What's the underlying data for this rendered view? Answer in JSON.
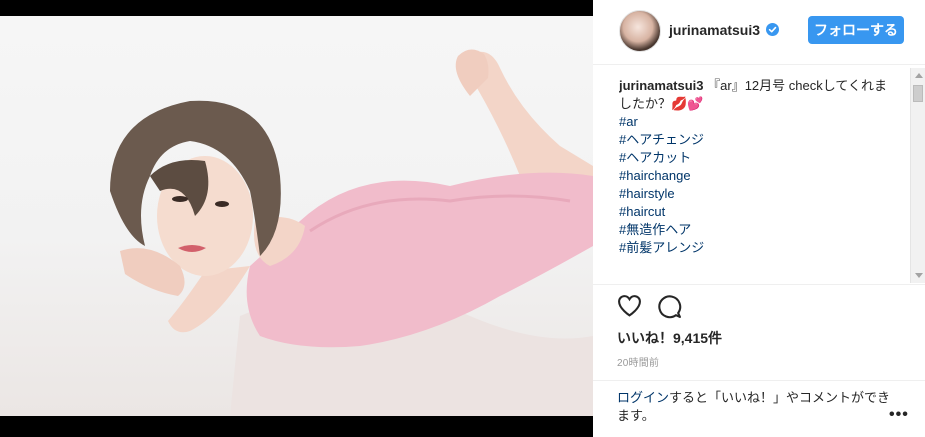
{
  "post": {
    "username": "jurinamatsui3",
    "follow_label": "フォローする",
    "caption_user": "jurinamatsui3",
    "caption_text": " 『ar』12月号 checkしてくれましたか？💋💕",
    "hashtags": [
      "#ar",
      "#ヘアチェンジ",
      "#ヘアカット",
      "#hairchange",
      "#hairstyle",
      "#haircut",
      "#無造作ヘア",
      "#前髪アレンジ"
    ],
    "likes": "いいね！9,415件",
    "time": "20時間前",
    "login_link": "ログイン",
    "login_text": "すると「いいね！」やコメントができます。",
    "more_label": "•••"
  },
  "icons": {
    "verified": "verified-badge-icon",
    "like": "heart-icon",
    "comment": "comment-icon"
  },
  "colors": {
    "accent": "#3897f0",
    "hashtag": "#003569",
    "text": "#262626"
  }
}
